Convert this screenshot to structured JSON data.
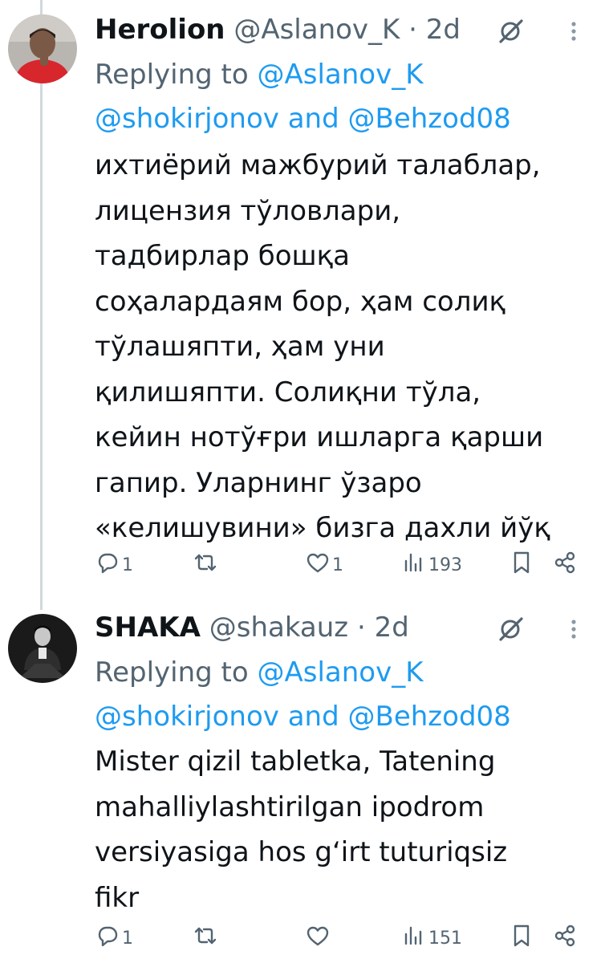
{
  "tweets": [
    {
      "display_name": "Herolion",
      "handle": "@Aslanov_K",
      "separator": "·",
      "age": "2d",
      "replying_label": "Replying to",
      "mentions": [
        "@Aslanov_K",
        "@shokirjonov",
        "@Behzod08"
      ],
      "and_label": "and",
      "text": "ихтиёрий мажбурий талаблар,\nлицензия тўловлари,\nтадбирлар бошқа\nсоҳалардаям бор, ҳам солиқ\nтўлашяпти, ҳам уни\nқилишяпти. Солиқни тўла,\nкейин нотўғри ишларга қарши\nгапир.  Уларнинг ўзаро\n«келишувини» бизга дахли йўқ",
      "reply_count": "1",
      "repost_count": "",
      "like_count": "1",
      "view_count": "193"
    },
    {
      "display_name": "SHAKA",
      "handle": "@shakauz",
      "separator": "·",
      "age": "2d",
      "replying_label": "Replying to",
      "mentions": [
        "@Aslanov_K",
        "@shokirjonov",
        "@Behzod08"
      ],
      "and_label": "and",
      "text": "Mister qizil tabletka, Tatening\nmahalliylashtirilgan ipodrom\nversiyasiga hos g‘irt tuturiqsiz\nfikr",
      "reply_count": "1",
      "repost_count": "",
      "like_count": "",
      "view_count": "151"
    }
  ],
  "icons": {
    "grok": "grok-icon",
    "more": "more-vertical-icon",
    "reply": "reply-icon",
    "repost": "repost-icon",
    "like": "like-icon",
    "views": "views-icon",
    "bookmark": "bookmark-icon",
    "share": "share-icon"
  },
  "colors": {
    "text": "#0f1419",
    "secondary": "#536471",
    "link": "#1d9bf0",
    "thread_line": "#cfd9de"
  }
}
